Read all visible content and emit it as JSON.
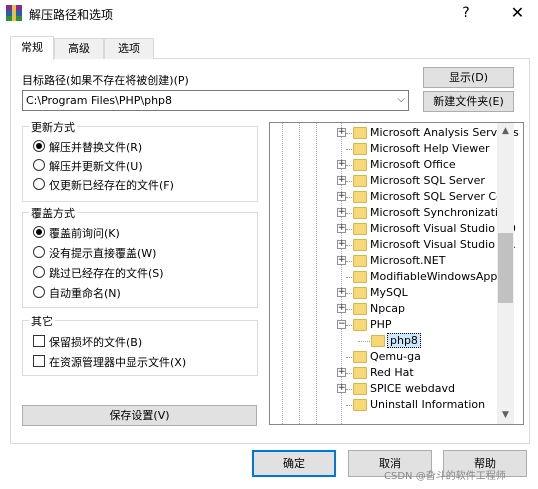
{
  "window": {
    "title": "解压路径和选项",
    "help_glyph": "?",
    "close_glyph": "✕"
  },
  "tabs": [
    {
      "label": "常规",
      "active": true
    },
    {
      "label": "高级",
      "active": false
    },
    {
      "label": "选项",
      "active": false
    }
  ],
  "dest": {
    "label": "目标路径(如果不存在将被创建)(P)",
    "value": "C:\\Program Files\\PHP\\php8",
    "show_button": "显示(D)",
    "new_folder_button": "新建文件夹(E)"
  },
  "update_mode": {
    "title": "更新方式",
    "options": [
      {
        "label": "解压并替换文件(R)",
        "selected": true
      },
      {
        "label": "解压并更新文件(U)",
        "selected": false
      },
      {
        "label": "仅更新已经存在的文件(F)",
        "selected": false
      }
    ]
  },
  "overwrite_mode": {
    "title": "覆盖方式",
    "options": [
      {
        "label": "覆盖前询问(K)",
        "selected": true
      },
      {
        "label": "没有提示直接覆盖(W)",
        "selected": false
      },
      {
        "label": "跳过已经存在的文件(S)",
        "selected": false
      },
      {
        "label": "自动重命名(N)",
        "selected": false
      }
    ]
  },
  "misc": {
    "title": "其它",
    "options": [
      {
        "label": "保留损坏的文件(B)",
        "checked": false
      },
      {
        "label": "在资源管理器中显示文件(X)",
        "checked": false
      }
    ]
  },
  "save_settings_button": "保存设置(V)",
  "folder_tree": {
    "items": [
      {
        "label": "Microsoft Analysis Services",
        "expander": "+"
      },
      {
        "label": "Microsoft Help Viewer",
        "expander": ""
      },
      {
        "label": "Microsoft Office",
        "expander": "+"
      },
      {
        "label": "Microsoft SQL Server",
        "expander": "+"
      },
      {
        "label": "Microsoft SQL Server Com",
        "expander": "+"
      },
      {
        "label": "Microsoft Synchronization",
        "expander": "+"
      },
      {
        "label": "Microsoft Visual Studio 9.0",
        "expander": "+"
      },
      {
        "label": "Microsoft Visual Studio 10.",
        "expander": "+"
      },
      {
        "label": "Microsoft.NET",
        "expander": "+"
      },
      {
        "label": "ModifiableWindowsApps",
        "expander": ""
      },
      {
        "label": "MySQL",
        "expander": "+"
      },
      {
        "label": "Npcap",
        "expander": "+"
      },
      {
        "label": "PHP",
        "expander": "−"
      },
      {
        "label": "php8",
        "expander": "",
        "selected": true
      },
      {
        "label": "Qemu-ga",
        "expander": ""
      },
      {
        "label": "Red Hat",
        "expander": "+"
      },
      {
        "label": "SPICE webdavd",
        "expander": "+"
      },
      {
        "label": "Uninstall Information",
        "expander": ""
      }
    ],
    "scroll_up_glyph": "▲",
    "scroll_down_glyph": "▼"
  },
  "footer": {
    "ok": "确定",
    "cancel": "取消",
    "help": "帮助",
    "watermark": "CSDN @旮斗的软件工程师"
  },
  "colors": {
    "accent": "#0078d7",
    "folder": "#f8d775",
    "selection": "#cce8ff"
  }
}
